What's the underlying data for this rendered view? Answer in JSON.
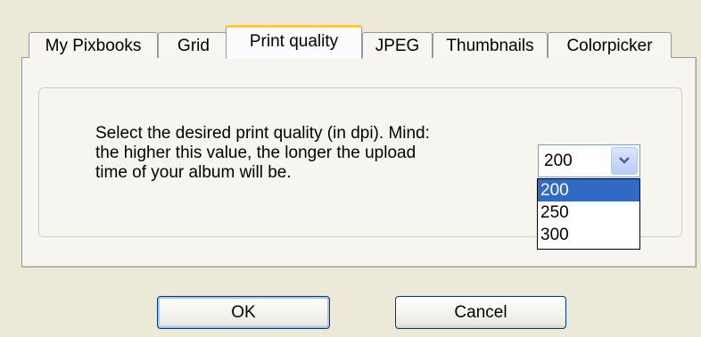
{
  "tabs": [
    {
      "label": "My Pixbooks"
    },
    {
      "label": "Grid"
    },
    {
      "label": "Print quality",
      "active": true
    },
    {
      "label": "JPEG"
    },
    {
      "label": "Thumbnails"
    },
    {
      "label": "Colorpicker"
    }
  ],
  "print_quality": {
    "description_lines": [
      "Select the desired print quality (in dpi). Mind:",
      "the higher this value, the longer the upload",
      "time of your album will be."
    ],
    "selected_value": "200",
    "options": [
      "200",
      "250",
      "300"
    ]
  },
  "buttons": {
    "ok_label": "OK",
    "cancel_label": "Cancel"
  },
  "colors": {
    "active_tab_accent": "#ffc83c",
    "selection_highlight": "#316ac5"
  }
}
